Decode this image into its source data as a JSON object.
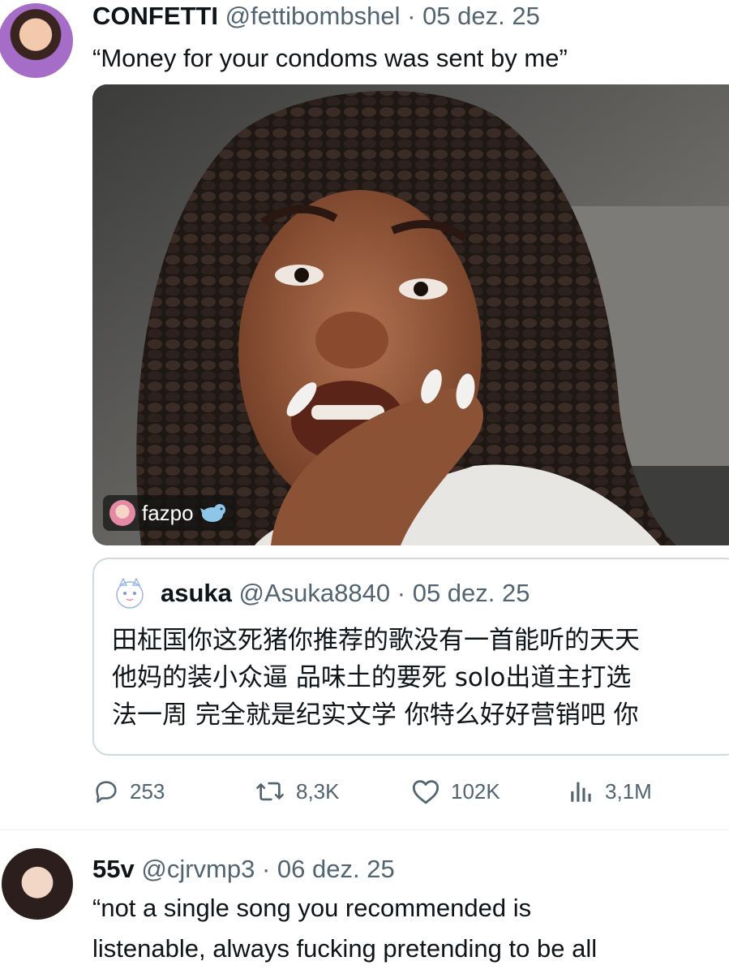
{
  "post1": {
    "author_name": "CONFETTI",
    "handle": "@fettibombshel",
    "separator": "·",
    "date": "05 dez. 25",
    "text": "“Money for your condoms was sent by me”",
    "media_tag": "fazpo",
    "quote": {
      "author_name": "asuka",
      "handle": "@Asuka8840",
      "separator": "·",
      "date": "05 dez. 25",
      "lines": [
        "田柾国你这死猪你推荐的歌没有一首能听的天天",
        "他妈的装小众逼 品味土的要死 solo出道主打选",
        "法一周 完全就是纪实文学 你特么好好营销吧 你"
      ]
    },
    "actions": {
      "replies": "253",
      "reposts": "8,3K",
      "likes": "102K",
      "views": "3,1M"
    }
  },
  "post2": {
    "author_name": "55v",
    "handle": "@cjrvmp3",
    "separator": "·",
    "date": "06 dez. 25",
    "lines": [
      "“not a single song you recommended is",
      "listenable, always fucking pretending to be all"
    ]
  },
  "colors": {
    "text": "#0f1419",
    "muted": "#536471",
    "border": "#cfd9de"
  },
  "icons": [
    "reply-icon",
    "repost-icon",
    "like-icon",
    "views-icon",
    "seal-emoji-icon"
  ]
}
